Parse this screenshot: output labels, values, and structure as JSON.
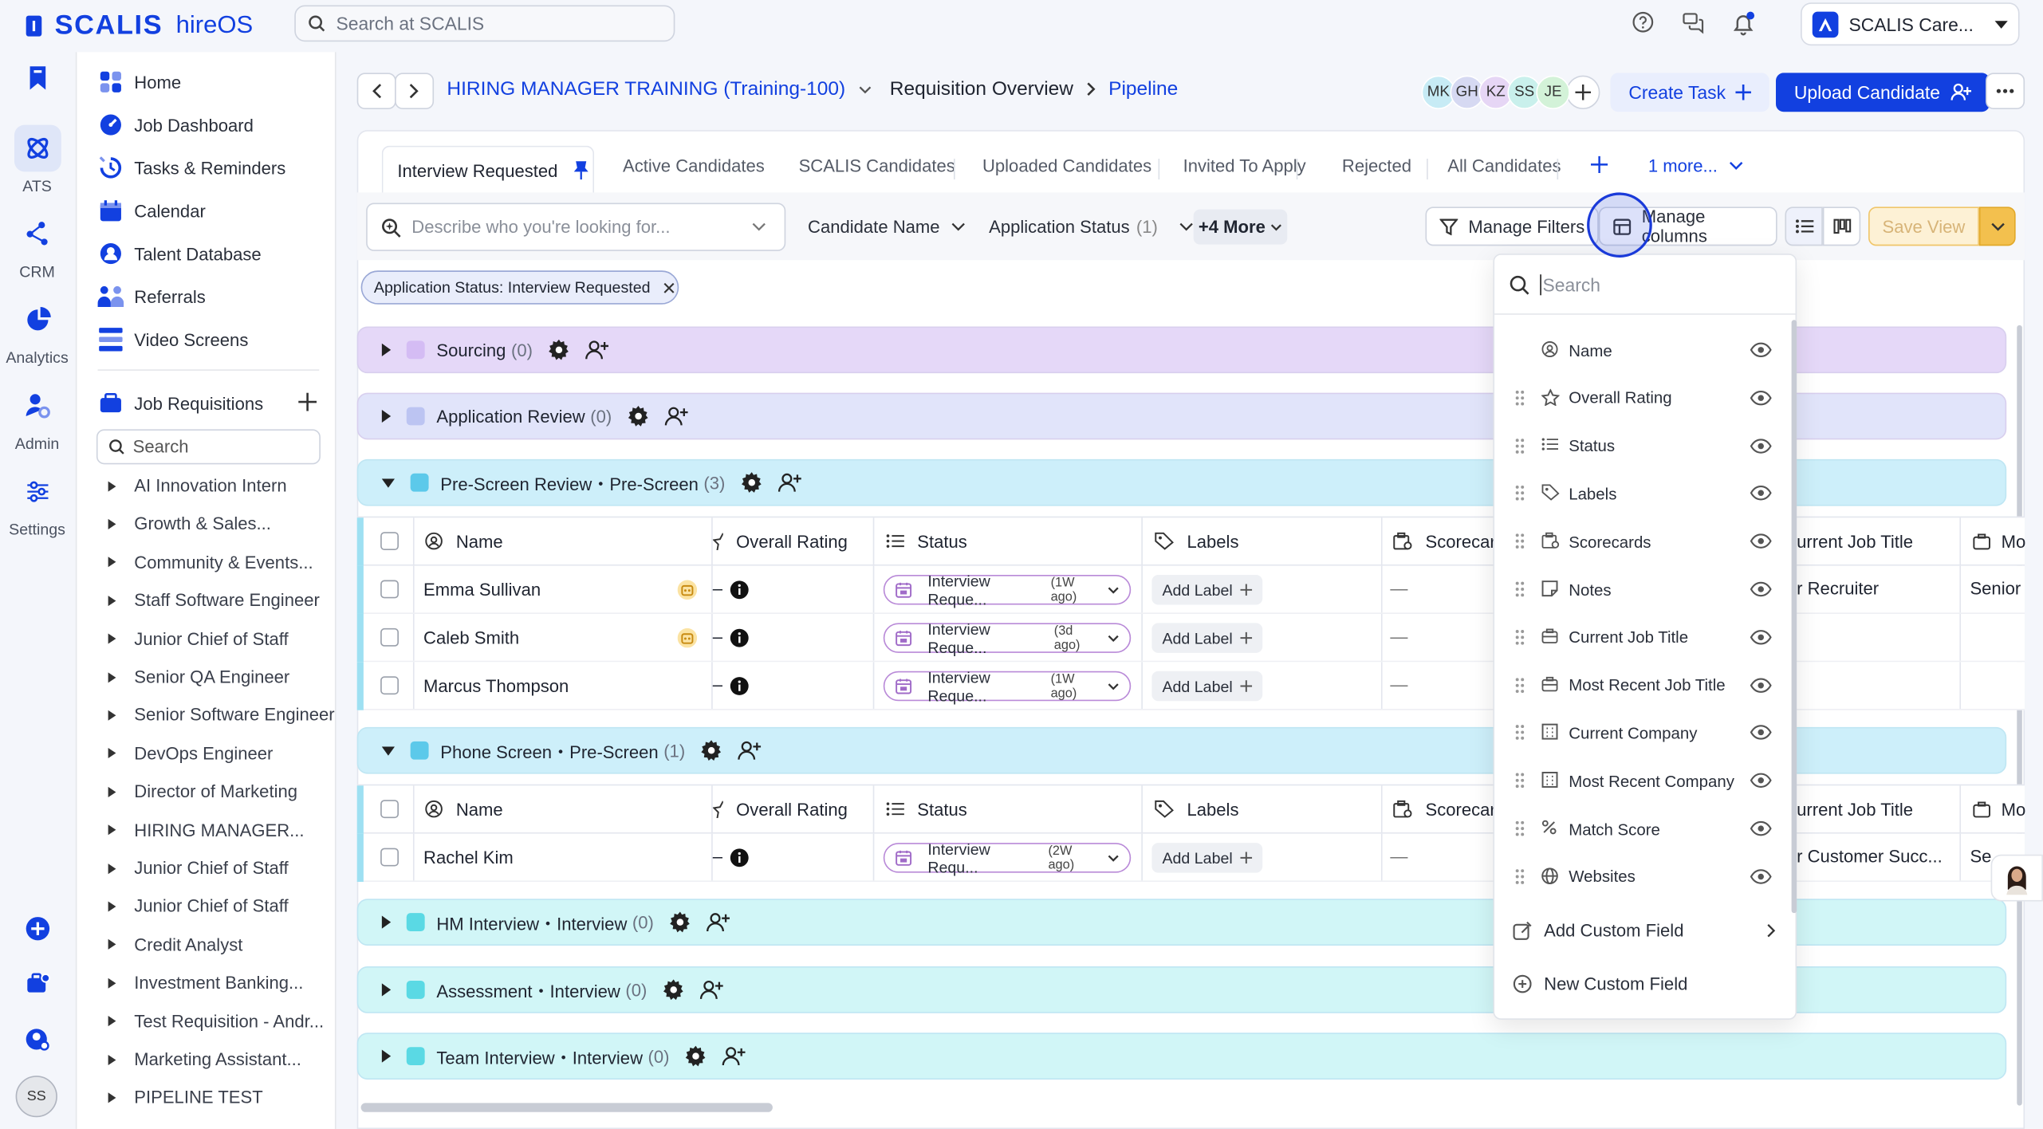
{
  "app": {
    "brand": "SCALIS",
    "product": "hireOS"
  },
  "topbar": {
    "search_placeholder": "Search at SCALIS",
    "company": "SCALIS Care..."
  },
  "rail": {
    "items": [
      {
        "label": "ATS",
        "icon": "ats-icon"
      },
      {
        "label": "CRM",
        "icon": "crm-icon"
      },
      {
        "label": "Analytics",
        "icon": "analytics-icon"
      },
      {
        "label": "Admin",
        "icon": "admin-icon"
      },
      {
        "label": "Settings",
        "icon": "settings-icon"
      }
    ],
    "user_initials": "SS"
  },
  "nav": {
    "items": [
      {
        "label": "Home",
        "icon": "home-icon"
      },
      {
        "label": "Job Dashboard",
        "icon": "dashboard-icon"
      },
      {
        "label": "Tasks & Reminders",
        "icon": "tasks-icon"
      },
      {
        "label": "Calendar",
        "icon": "calendar-icon"
      },
      {
        "label": "Talent Database",
        "icon": "talent-icon"
      },
      {
        "label": "Referrals",
        "icon": "referrals-icon"
      },
      {
        "label": "Video Screens",
        "icon": "video-icon"
      }
    ],
    "job_requisitions_label": "Job Requisitions",
    "search_placeholder": "Search",
    "requisitions": [
      "AI Innovation Intern",
      "Growth & Sales...",
      "Community & Events...",
      "Staff Software Engineer",
      "Junior Chief of Staff",
      "Senior QA Engineer",
      "Senior Software Engineer",
      "DevOps Engineer",
      "Director of Marketing",
      "HIRING MANAGER...",
      "Junior Chief of Staff",
      "Junior Chief of Staff",
      "Credit Analyst",
      "Investment Banking...",
      "Test Requisition - Andr...",
      "Marketing Assistant...",
      "PIPELINE TEST"
    ]
  },
  "header": {
    "requisition": "HIRING MANAGER TRAINING (Training-100)",
    "overview": "Requisition Overview",
    "current": "Pipeline",
    "avatars": [
      {
        "initials": "MK",
        "color": "#c7ebf5"
      },
      {
        "initials": "GH",
        "color": "#d6d9f2"
      },
      {
        "initials": "KZ",
        "color": "#e6d6f5"
      },
      {
        "initials": "SS",
        "color": "#c9f0ec"
      },
      {
        "initials": "JE",
        "color": "#d3f2d8"
      }
    ],
    "create_task": "Create Task",
    "upload_candidate": "Upload Candidate"
  },
  "tabs": {
    "active": "Interview Requested",
    "items": [
      "Active Candidates",
      "SCALIS Candidates",
      "Uploaded Candidates",
      "Invited To Apply",
      "Rejected",
      "All Candidates"
    ],
    "more": "1 more..."
  },
  "filters": {
    "describe_placeholder": "Describe who you're looking for...",
    "candidate_name": "Candidate Name",
    "application_status": "Application Status",
    "application_status_count": "(1)",
    "more": "+4 More",
    "manage_filters": "Manage Filters",
    "manage_columns": "Manage columns",
    "save_view": "Save View",
    "active_chip": "Application Status: Interview Requested"
  },
  "groups": [
    {
      "name": "Sourcing",
      "count": "(0)",
      "color": "#e5d8f8",
      "swatch": "#d4bcf4"
    },
    {
      "name": "Application Review",
      "count": "(0)",
      "color": "#e1e4fa",
      "swatch": "#bcc4f2"
    },
    {
      "name": "Pre-Screen Review・Pre-Screen",
      "count": "(3)",
      "color": "#cdeffa",
      "swatch": "#5cc9ea"
    },
    {
      "name": "Phone Screen・Pre-Screen",
      "count": "(1)",
      "color": "#cdeffa",
      "swatch": "#5cc9ea"
    },
    {
      "name": "HM Interview・Interview",
      "count": "(0)",
      "color": "#d1f6f7",
      "swatch": "#5ad9e4"
    },
    {
      "name": "Assessment・Interview",
      "count": "(0)",
      "color": "#d1f6f7",
      "swatch": "#5ad9e4"
    },
    {
      "name": "Team Interview・Interview",
      "count": "(0)",
      "color": "#d1f6f7",
      "swatch": "#5ad9e4"
    }
  ],
  "table": {
    "columns": {
      "name": "Name",
      "overall_rating": "Overall Rating",
      "status": "Status",
      "labels": "Labels",
      "scorecards": "Scorecard",
      "current_job_title": "urrent Job Title",
      "next": "Mo"
    },
    "rating_placeholder": "–",
    "dash": "—",
    "add_label": "Add Label",
    "prescreen_rows": [
      {
        "name": "Emma Sullivan",
        "status": "Interview Reque...",
        "age": "(1W ago)",
        "job_title": "r Recruiter",
        "next": "Senior"
      },
      {
        "name": "Caleb Smith",
        "status": "Interview Reque...",
        "age": "(3d ago)",
        "job_title": "",
        "next": ""
      },
      {
        "name": "Marcus Thompson",
        "status": "Interview Reque...",
        "age": "(1W ago)",
        "job_title": "",
        "next": ""
      }
    ],
    "phonescreen_rows": [
      {
        "name": "Rachel Kim",
        "status": "Interview Requ...",
        "age": "(2W ago)",
        "job_title": "r Customer Succ...",
        "next": "Se"
      }
    ]
  },
  "column_menu": {
    "search_placeholder": "Search",
    "items": [
      {
        "label": "Name",
        "icon": "person-icon"
      },
      {
        "label": "Overall Rating",
        "icon": "star-icon"
      },
      {
        "label": "Status",
        "icon": "list-icon"
      },
      {
        "label": "Labels",
        "icon": "tag-icon"
      },
      {
        "label": "Scorecards",
        "icon": "scorecard-icon"
      },
      {
        "label": "Notes",
        "icon": "note-icon"
      },
      {
        "label": "Current Job Title",
        "icon": "briefcase-icon"
      },
      {
        "label": "Most Recent Job Title",
        "icon": "briefcase-icon"
      },
      {
        "label": "Current Company",
        "icon": "building-icon"
      },
      {
        "label": "Most Recent Company",
        "icon": "building-icon"
      },
      {
        "label": "Match Score",
        "icon": "percent-icon"
      },
      {
        "label": "Websites",
        "icon": "globe-icon"
      }
    ],
    "add_custom_field": "Add Custom Field",
    "new_custom_field": "New Custom Field"
  },
  "colors": {
    "accent": "#1240e0",
    "save_view": "#f3c04e"
  }
}
